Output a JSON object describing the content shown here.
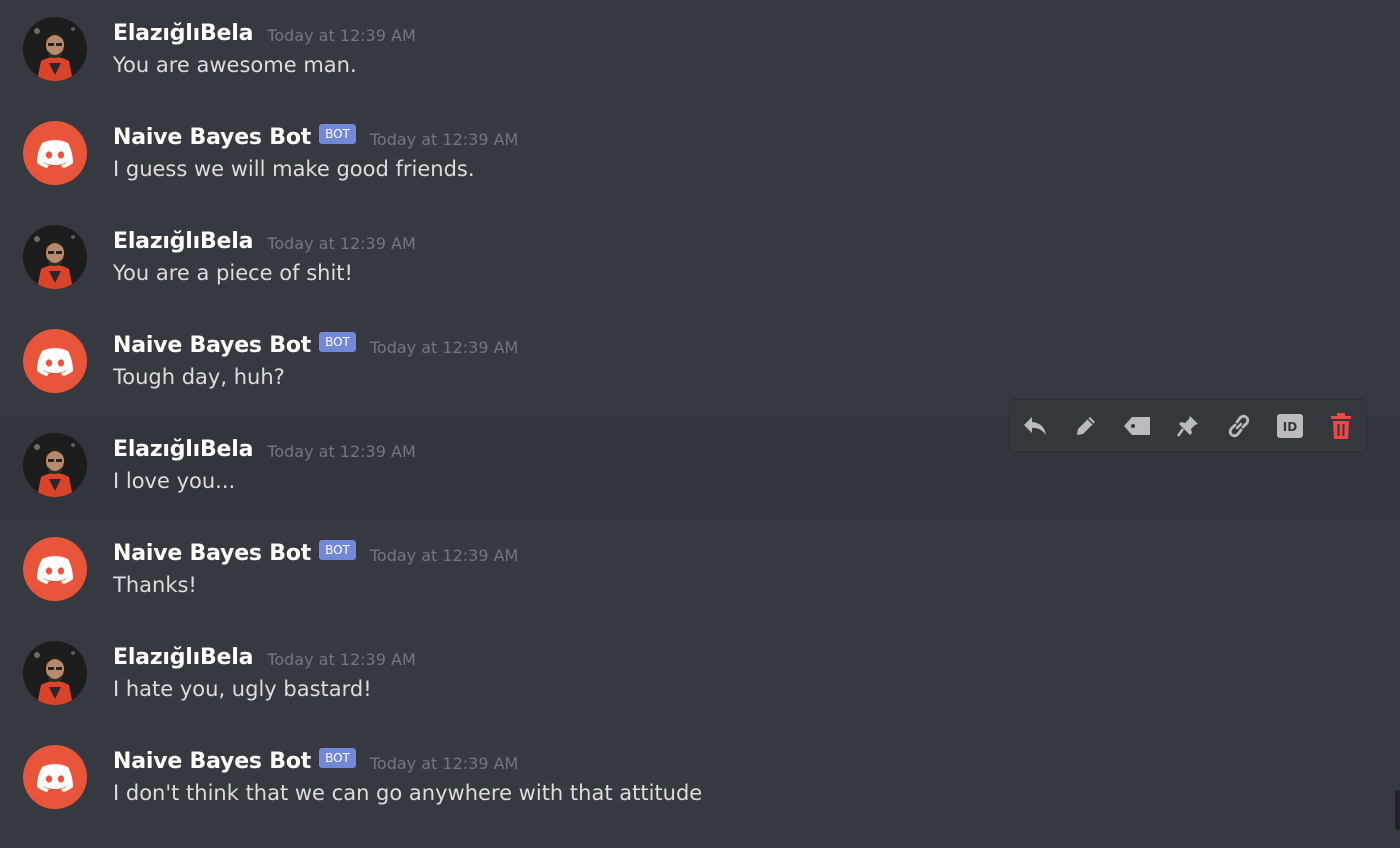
{
  "users": {
    "human": {
      "name": "ElazığlıBela"
    },
    "bot": {
      "name": "Naive Bayes Bot",
      "tag": "BOT"
    }
  },
  "colors": {
    "background": "#36393f",
    "bot_avatar": "#e8553a",
    "bot_tag": "#7289da",
    "delete_icon": "#f04747"
  },
  "messages": [
    {
      "author": "ElazığlıBela",
      "is_bot": false,
      "timestamp": "Today at 12:39 AM",
      "text": "You are awesome man."
    },
    {
      "author": "Naive Bayes Bot",
      "is_bot": true,
      "tag": "BOT",
      "timestamp": "Today at 12:39 AM",
      "text": "I guess we will make good friends."
    },
    {
      "author": "ElazığlıBela",
      "is_bot": false,
      "timestamp": "Today at 12:39 AM",
      "text": "You are a piece of shit!"
    },
    {
      "author": "Naive Bayes Bot",
      "is_bot": true,
      "tag": "BOT",
      "timestamp": "Today at 12:39 AM",
      "text": "Tough day, huh?"
    },
    {
      "author": "ElazığlıBela",
      "is_bot": false,
      "timestamp": "Today at 12:39 AM",
      "text": "I love you..."
    },
    {
      "author": "Naive Bayes Bot",
      "is_bot": true,
      "tag": "BOT",
      "timestamp": "Today at 12:39 AM",
      "text": "Thanks!"
    },
    {
      "author": "ElazığlıBela",
      "is_bot": false,
      "timestamp": "Today at 12:39 AM",
      "text": "I hate you, ugly bastard!"
    },
    {
      "author": "Naive Bayes Bot",
      "is_bot": true,
      "tag": "BOT",
      "timestamp": "Today at 12:39 AM",
      "text": "I don't think that we can go anywhere with that attitude"
    }
  ],
  "hover_toolbar": {
    "buttons": [
      {
        "icon": "reply-icon"
      },
      {
        "icon": "pencil-icon"
      },
      {
        "icon": "tag-icon"
      },
      {
        "icon": "pin-icon"
      },
      {
        "icon": "link-icon"
      },
      {
        "icon": "id-icon",
        "text": "ID"
      },
      {
        "icon": "trash-icon"
      }
    ]
  }
}
